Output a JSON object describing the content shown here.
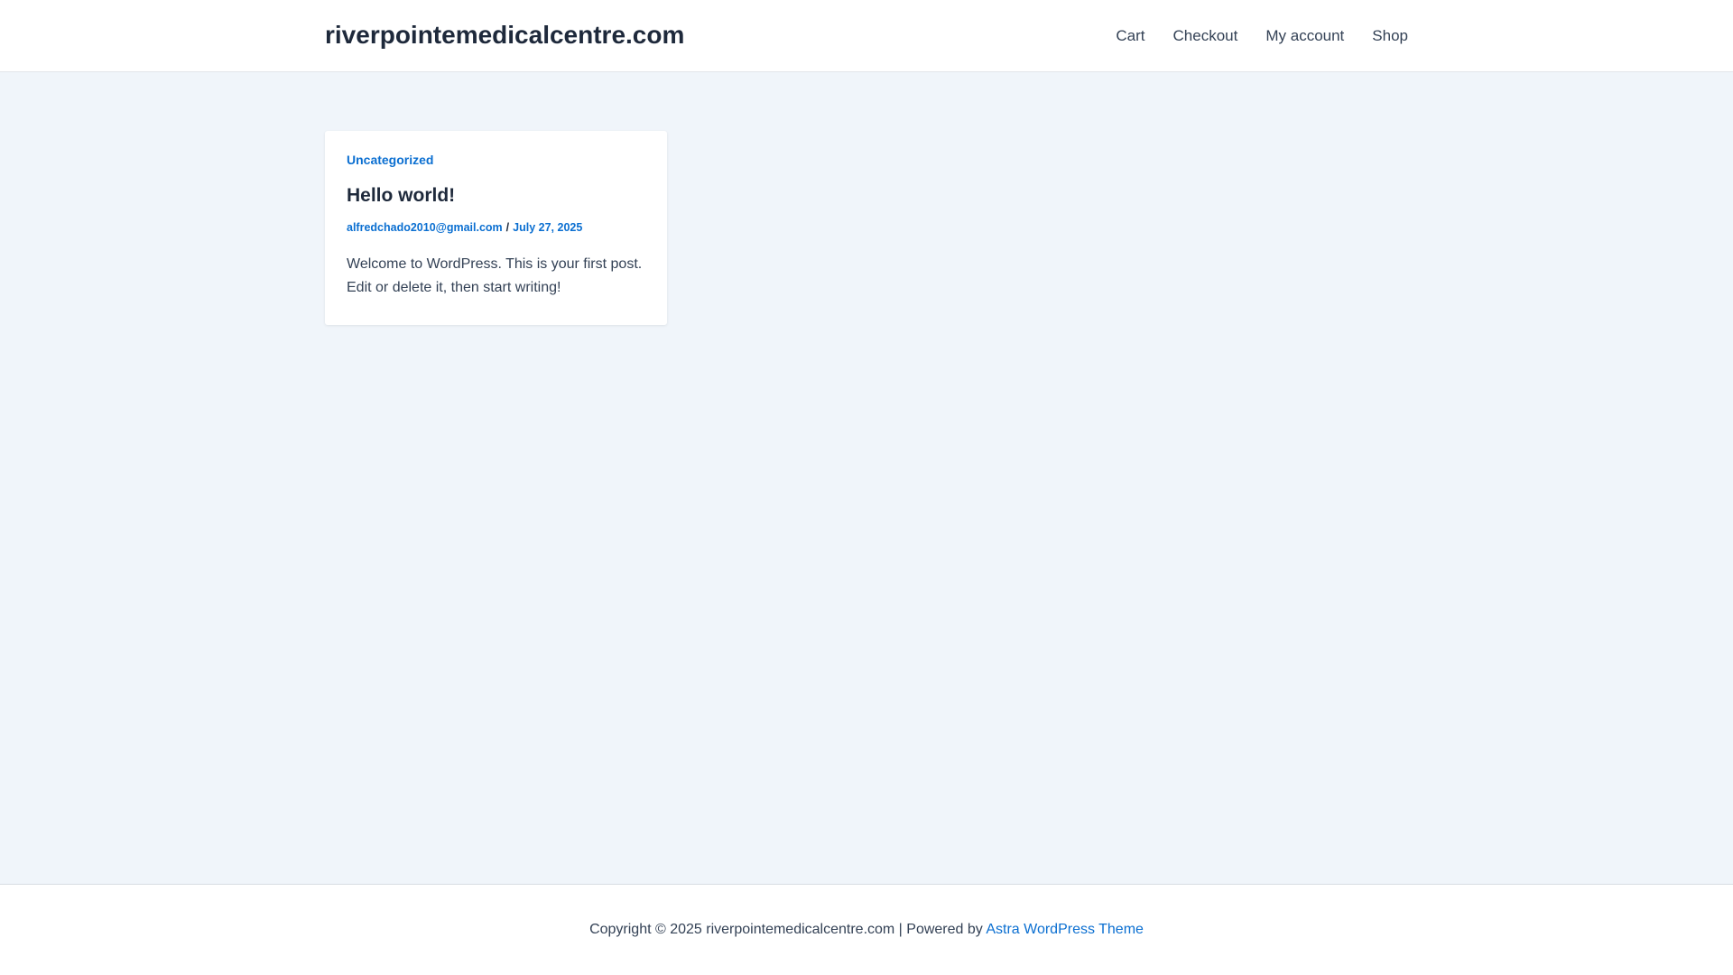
{
  "header": {
    "site_title": "riverpointemedicalcentre.com",
    "nav": [
      {
        "label": "Cart"
      },
      {
        "label": "Checkout"
      },
      {
        "label": "My account"
      },
      {
        "label": "Shop"
      }
    ]
  },
  "post": {
    "category": "Uncategorized",
    "title": "Hello world!",
    "author": "alfredchado2010@gmail.com",
    "separator": "/",
    "date": "July 27, 2025",
    "excerpt": "Welcome to WordPress. This is your first post. Edit or delete it, then start writing!"
  },
  "footer": {
    "copyright_text": "Copyright © 2025 riverpointemedicalcentre.com | Powered by ",
    "theme_link": "Astra WordPress Theme"
  },
  "colors": {
    "accent": "#0b6fd1",
    "background": "#f0f5fa",
    "heading": "#1e293b",
    "body_text": "#334155"
  }
}
